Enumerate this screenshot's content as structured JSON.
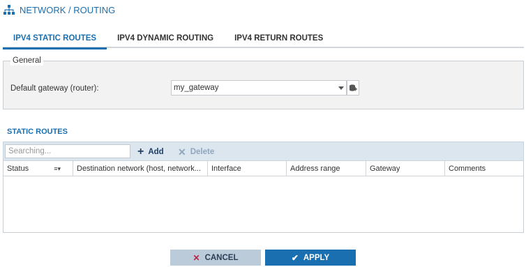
{
  "header": {
    "title": "NETWORK / ROUTING",
    "icon": "network-icon"
  },
  "tabs": [
    {
      "label": "IPV4 STATIC ROUTES",
      "active": true
    },
    {
      "label": "IPV4 DYNAMIC ROUTING",
      "active": false
    },
    {
      "label": "IPV4 RETURN ROUTES",
      "active": false
    }
  ],
  "general": {
    "legend": "General",
    "gateway_label": "Default gateway (router):",
    "gateway_value": "my_gateway"
  },
  "static_routes": {
    "title": "STATIC ROUTES",
    "search_placeholder": "Searching...",
    "add_label": "Add",
    "delete_label": "Delete",
    "columns": [
      "Status",
      "Destination network (host, network...",
      "Interface",
      "Address range",
      "Gateway",
      "Comments"
    ]
  },
  "footer": {
    "cancel_label": "CANCEL",
    "apply_label": "APPLY"
  },
  "colors": {
    "accent": "#1a6fb0",
    "toolbar_bg": "#dce6ef",
    "cancel_bg": "#bccbda",
    "cancel_icon": "#b0264a"
  }
}
